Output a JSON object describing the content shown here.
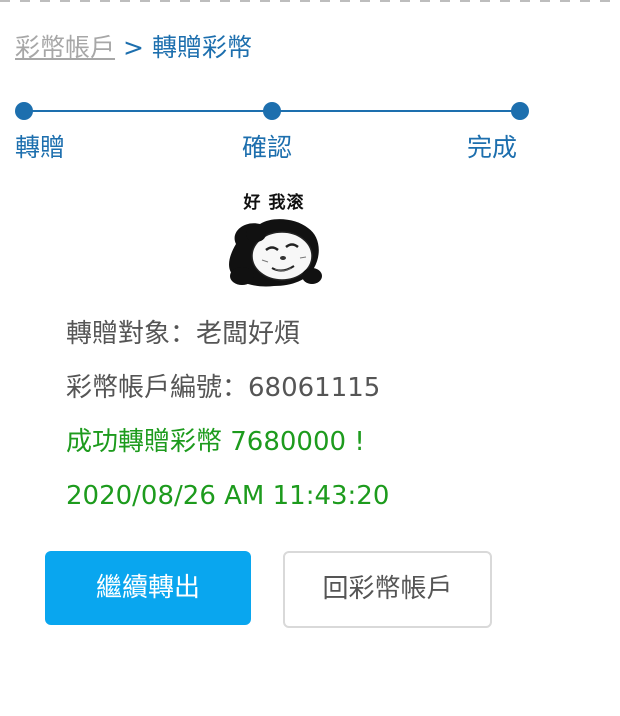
{
  "breadcrumb": {
    "parent": "彩幣帳戶",
    "separator": ">",
    "current": "轉贈彩幣"
  },
  "stepper": {
    "steps": [
      {
        "label": "轉贈"
      },
      {
        "label": "確認"
      },
      {
        "label": "完成"
      }
    ],
    "current_step": 3,
    "color": "#1d6fae"
  },
  "sticker": {
    "caption": "好 我滚",
    "icon": "panda-meme-sticker"
  },
  "result": {
    "recipient_line": "轉贈對象：老闆好煩",
    "account_line": "彩幣帳戶編號：68061115",
    "success_line": "成功轉贈彩幣 7680000 !",
    "timestamp": "2020/08/26 AM 11:43:20"
  },
  "actions": {
    "continue_label": "繼續轉出",
    "back_label": "回彩幣帳戶"
  },
  "colors": {
    "primary_button": "#09a6ef",
    "success_text": "#1d9b1d",
    "body_text": "#555555"
  }
}
